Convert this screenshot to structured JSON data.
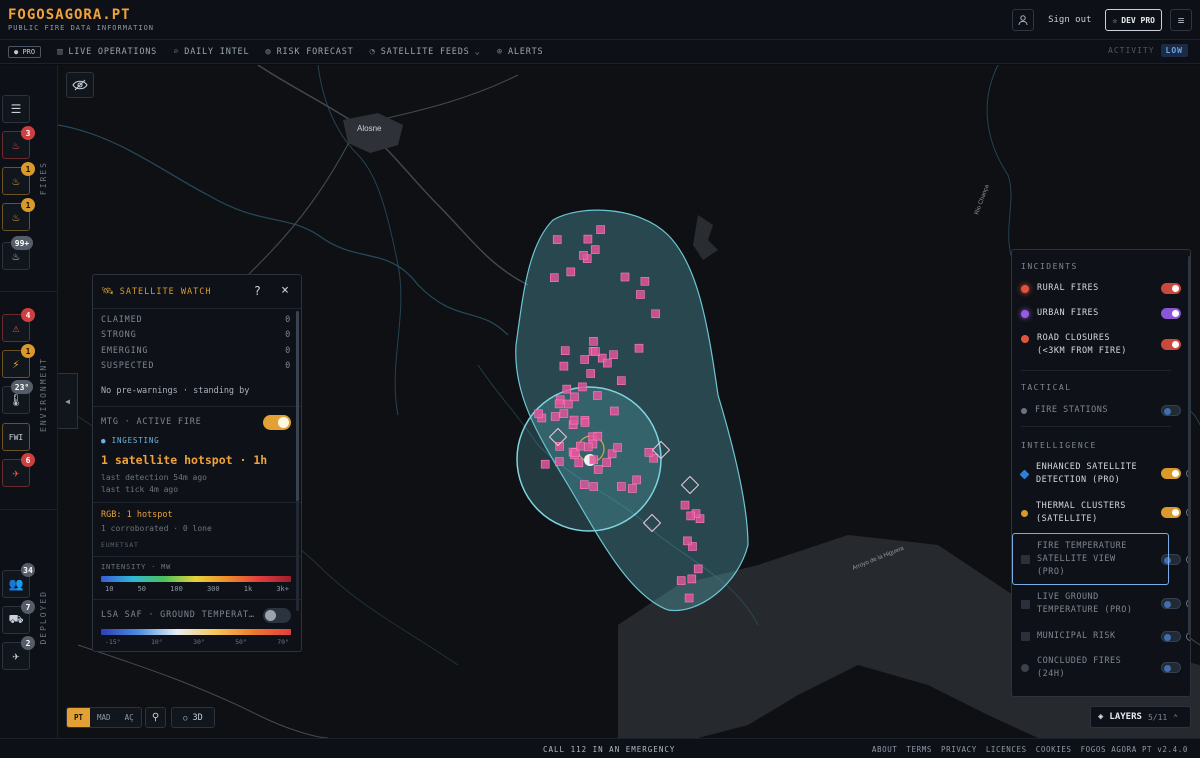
{
  "brand": {
    "title": "FOGOSAGORA.PT",
    "subtitle": "PUBLIC FIRE DATA INFORMATION"
  },
  "header": {
    "signout": "Sign out",
    "devpro": "DEV PRO",
    "user_icon": "user-icon",
    "menu_icon": "menu-icon"
  },
  "nav": {
    "pro_badge": "PRO",
    "items": [
      {
        "label": "LIVE OPERATIONS",
        "icon": "bar-chart-icon"
      },
      {
        "label": "DAILY INTEL",
        "icon": "search-icon"
      },
      {
        "label": "RISK FORECAST",
        "icon": "globe-icon"
      },
      {
        "label": "SATELLITE FEEDS",
        "icon": "satellite-icon"
      },
      {
        "label": "ALERTS",
        "icon": "plus-circle-icon"
      }
    ],
    "activity_label": "ACTIVITY",
    "activity_level": "LOW"
  },
  "rail": {
    "fires_label": "FIRES",
    "environment_label": "ENVIRONMENT",
    "deployed_label": "DEPLOYED",
    "fire_counts": [
      "3",
      "1",
      "1",
      "99+"
    ],
    "env_counts": [
      "4",
      "1",
      "23°",
      "",
      "6"
    ],
    "env_fwi": "FWI",
    "deployed_counts": [
      "34",
      "7",
      "2"
    ]
  },
  "map": {
    "place_label": "Alosne",
    "river_label_1": "Rio Chança",
    "river_label_2": "Arroyo de la Higuera"
  },
  "satellite_panel": {
    "title": "SATELLITE WATCH",
    "help": "?",
    "close": "×",
    "stats": [
      {
        "label": "CLAIMED",
        "value": "0"
      },
      {
        "label": "STRONG",
        "value": "0"
      },
      {
        "label": "EMERGING",
        "value": "0"
      },
      {
        "label": "SUSPECTED",
        "value": "0"
      }
    ],
    "no_warnings": "No pre-warnings · standing by",
    "mtg_label": "MTG · ACTIVE FIRE",
    "ingesting": "INGESTING",
    "hotspot": "1 satellite hotspot · 1h",
    "last_detection": "last detection 54m ago",
    "last_tick": "last tick 4m ago",
    "rgb": "RGB: 1 hotspot",
    "corroborated": "1 corroborated · 0 lone",
    "source": "EUMETSAT",
    "intensity_label": "INTENSITY · MW",
    "intensity_ticks": [
      "10",
      "50",
      "100",
      "300",
      "1k",
      "3k+"
    ],
    "lsa_label": "LSA SAF · GROUND TEMPERAT…",
    "temp_ticks": [
      "-15°",
      "10°",
      "30°",
      "50°",
      "70°"
    ]
  },
  "controls": {
    "regions": [
      "PT",
      "MAD",
      "AÇ"
    ],
    "btn3d": "3D"
  },
  "layers_panel": {
    "incidents": "INCIDENTS",
    "tactical": "TACTICAL",
    "intelligence": "INTELLIGENCE",
    "rural": "RURAL FIRES",
    "urban": "URBAN FIRES",
    "road_l1": "ROAD CLOSURES",
    "road_l2": "(<3KM FROM FIRE)",
    "stations": "FIRE STATIONS",
    "enh_l1": "ENHANCED SATELLITE",
    "enh_l2": "DETECTION (PRO)",
    "thermal_l1": "THERMAL CLUSTERS",
    "thermal_l2": "(SATELLITE)",
    "ftemp_l1": "FIRE TEMPERATURE",
    "ftemp_l2": "SATELLITE VIEW",
    "ftemp_l3": "(PRO)",
    "lground_l1": "LIVE GROUND",
    "lground_l2": "TEMPERATURE (PRO)",
    "municipal": "MUNICIPAL RISK",
    "concl_l1": "CONCLUDED FIRES",
    "concl_l2": "(24H)",
    "button_label": "LAYERS",
    "button_count": "5/11"
  },
  "footer": {
    "emergency": "CALL 112 IN AN EMERGENCY",
    "links": [
      "ABOUT",
      "TERMS",
      "PRIVACY",
      "LICENCES",
      "COOKIES",
      "FOGOS AGORA PT v2.4.0"
    ]
  },
  "colors": {
    "accent": "#e3a035",
    "hotspot": "#e0559a",
    "zone": "#5bb8c8"
  }
}
